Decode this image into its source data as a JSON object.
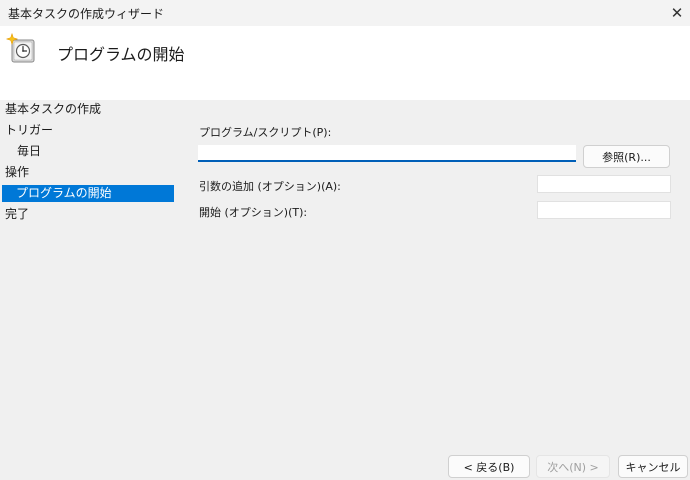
{
  "window": {
    "title": "基本タスクの作成ウィザード",
    "close_icon": "close-icon"
  },
  "header": {
    "icon": "task-scheduler-clock-icon",
    "title": "プログラムの開始"
  },
  "sidebar": {
    "items": [
      {
        "label": "基本タスクの作成",
        "selected": false
      },
      {
        "label": "トリガー",
        "selected": false
      },
      {
        "label": "毎日",
        "selected": false
      },
      {
        "label": "操作",
        "selected": false
      },
      {
        "label": "プログラムの開始",
        "selected": true
      },
      {
        "label": "完了",
        "selected": false
      }
    ]
  },
  "form": {
    "program_label": "プログラム/スクリプト(P):",
    "program_value": "",
    "browse_label": "参照(R)...",
    "arguments_label": "引数の追加 (オプション)(A):",
    "arguments_value": "",
    "start_in_label": "開始 (オプション)(T):",
    "start_in_value": ""
  },
  "footer": {
    "back_label": "< 戻る(B)",
    "next_label": "次へ(N) >",
    "next_enabled": false,
    "cancel_label": "キャンセル"
  },
  "colors": {
    "selection": "#0078d7",
    "focus_underline": "#005fb8",
    "background": "#f0f0f0",
    "header_background": "#ffffff"
  }
}
